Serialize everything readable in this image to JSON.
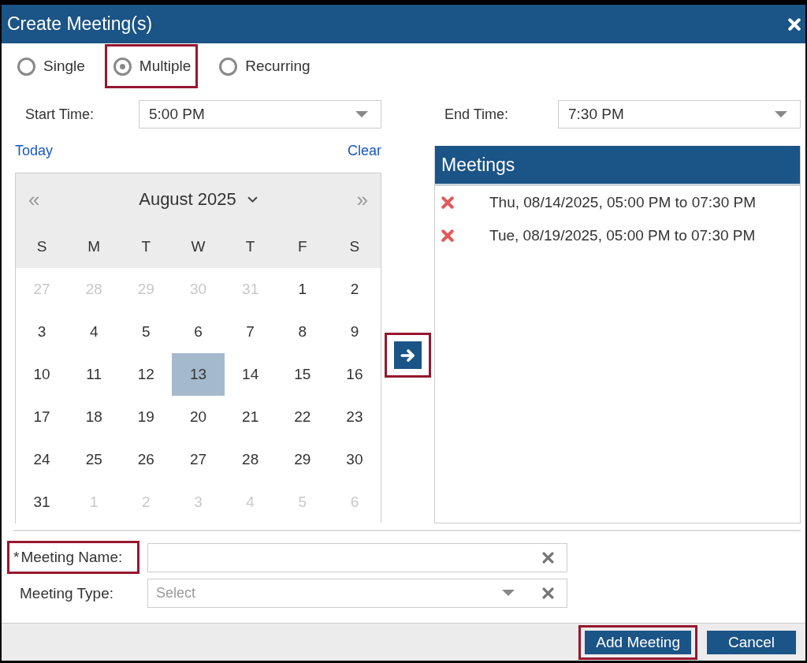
{
  "window": {
    "title": "Create Meeting(s)"
  },
  "modes": [
    {
      "label": "Single",
      "selected": false,
      "highlighted": false
    },
    {
      "label": "Multiple",
      "selected": true,
      "highlighted": true
    },
    {
      "label": "Recurring",
      "selected": false,
      "highlighted": false
    }
  ],
  "start_time": {
    "label": "Start Time:",
    "value": "5:00 PM"
  },
  "end_time": {
    "label": "End Time:",
    "value": "7:30 PM"
  },
  "calendar_links": {
    "today": "Today",
    "clear": "Clear"
  },
  "calendar": {
    "prev": "«",
    "next": "»",
    "month": "August 2025",
    "weekdays": [
      "S",
      "M",
      "T",
      "W",
      "T",
      "F",
      "S"
    ],
    "weeks": [
      [
        {
          "day": "27",
          "outside": true,
          "selected": false
        },
        {
          "day": "28",
          "outside": true,
          "selected": false
        },
        {
          "day": "29",
          "outside": true,
          "selected": false
        },
        {
          "day": "30",
          "outside": true,
          "selected": false
        },
        {
          "day": "31",
          "outside": true,
          "selected": false
        },
        {
          "day": "1",
          "outside": false,
          "selected": false
        },
        {
          "day": "2",
          "outside": false,
          "selected": false
        }
      ],
      [
        {
          "day": "3",
          "outside": false,
          "selected": false
        },
        {
          "day": "4",
          "outside": false,
          "selected": false
        },
        {
          "day": "5",
          "outside": false,
          "selected": false
        },
        {
          "day": "6",
          "outside": false,
          "selected": false
        },
        {
          "day": "7",
          "outside": false,
          "selected": false
        },
        {
          "day": "8",
          "outside": false,
          "selected": false
        },
        {
          "day": "9",
          "outside": false,
          "selected": false
        }
      ],
      [
        {
          "day": "10",
          "outside": false,
          "selected": false
        },
        {
          "day": "11",
          "outside": false,
          "selected": false
        },
        {
          "day": "12",
          "outside": false,
          "selected": false
        },
        {
          "day": "13",
          "outside": false,
          "selected": true
        },
        {
          "day": "14",
          "outside": false,
          "selected": false
        },
        {
          "day": "15",
          "outside": false,
          "selected": false
        },
        {
          "day": "16",
          "outside": false,
          "selected": false
        }
      ],
      [
        {
          "day": "17",
          "outside": false,
          "selected": false
        },
        {
          "day": "18",
          "outside": false,
          "selected": false
        },
        {
          "day": "19",
          "outside": false,
          "selected": false
        },
        {
          "day": "20",
          "outside": false,
          "selected": false
        },
        {
          "day": "21",
          "outside": false,
          "selected": false
        },
        {
          "day": "22",
          "outside": false,
          "selected": false
        },
        {
          "day": "23",
          "outside": false,
          "selected": false
        }
      ],
      [
        {
          "day": "24",
          "outside": false,
          "selected": false
        },
        {
          "day": "25",
          "outside": false,
          "selected": false
        },
        {
          "day": "26",
          "outside": false,
          "selected": false
        },
        {
          "day": "27",
          "outside": false,
          "selected": false
        },
        {
          "day": "28",
          "outside": false,
          "selected": false
        },
        {
          "day": "29",
          "outside": false,
          "selected": false
        },
        {
          "day": "30",
          "outside": false,
          "selected": false
        }
      ],
      [
        {
          "day": "31",
          "outside": false,
          "selected": false
        },
        {
          "day": "1",
          "outside": true,
          "selected": false
        },
        {
          "day": "2",
          "outside": true,
          "selected": false
        },
        {
          "day": "3",
          "outside": true,
          "selected": false
        },
        {
          "day": "4",
          "outside": true,
          "selected": false
        },
        {
          "day": "5",
          "outside": true,
          "selected": false
        },
        {
          "day": "6",
          "outside": true,
          "selected": false
        }
      ]
    ]
  },
  "add_arrow": {
    "highlighted": true
  },
  "meetings": {
    "title": "Meetings",
    "items": [
      "Thu, 08/14/2025, 05:00 PM to 07:30 PM",
      "Tue, 08/19/2025, 05:00 PM to 07:30 PM"
    ]
  },
  "meeting_name": {
    "required_mark": "*",
    "label": "Meeting Name:",
    "highlighted": true
  },
  "meeting_type": {
    "label": "Meeting Type:",
    "placeholder": "Select"
  },
  "buttons": [
    {
      "label": "Add Meeting",
      "highlighted": true
    },
    {
      "label": "Cancel",
      "highlighted": false
    }
  ]
}
